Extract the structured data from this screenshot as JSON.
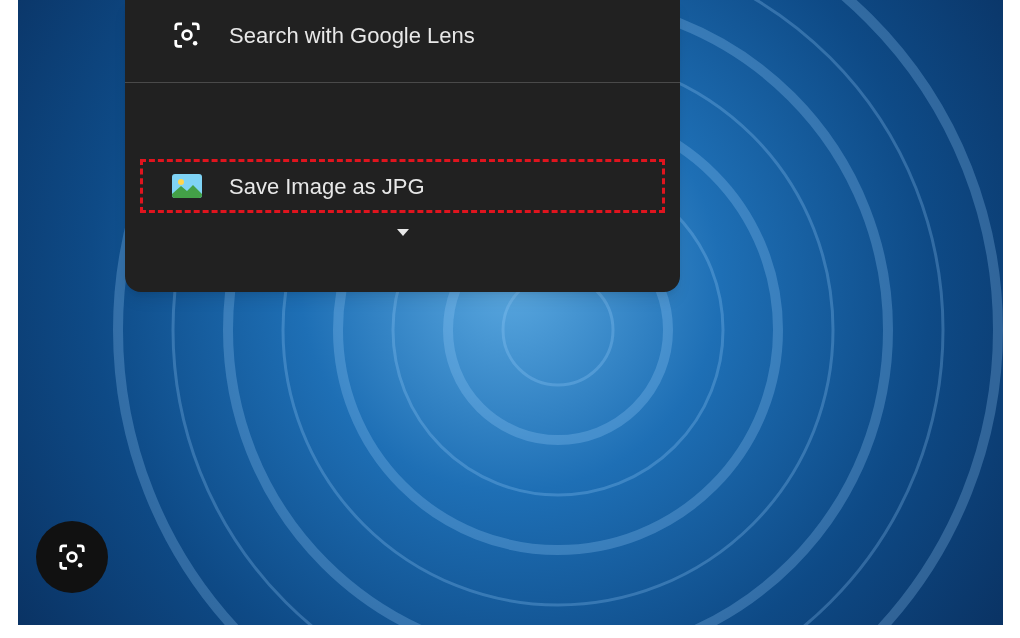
{
  "image": {
    "kind": "photo"
  },
  "context_menu": {
    "items": [
      {
        "kind": "lens",
        "label": "Search with Google Lens",
        "highlighted": false
      },
      {
        "kind": "divider"
      },
      {
        "kind": "spacer"
      },
      {
        "kind": "image",
        "label": "Save Image as JPG",
        "highlighted": true
      }
    ],
    "more": true
  },
  "lens_button": {
    "visible": true
  }
}
